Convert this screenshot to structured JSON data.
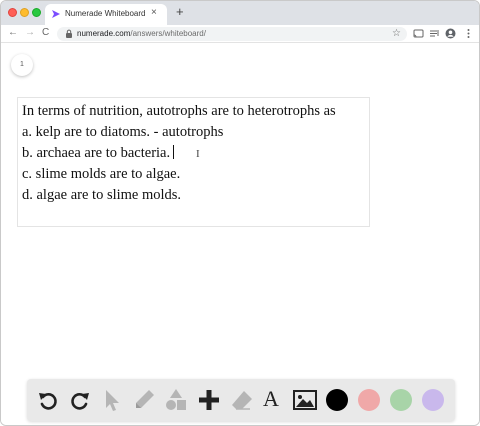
{
  "browser": {
    "tab_title": "Numerade Whiteboard",
    "tab_close": "×",
    "new_tab": "+",
    "nav_back": "←",
    "nav_forward": "→",
    "nav_reload": "C",
    "url_host": "numerade.com",
    "url_path": "/answers/whiteboard/",
    "bookmark": "☆"
  },
  "page": {
    "page_number": "1"
  },
  "question": {
    "lines": [
      "In terms of nutrition, autotrophs are to heterotrophs as",
      "a. kelp are to diatoms. - autotrophs",
      "b. archaea are to bacteria.",
      "c. slime molds are to algae.",
      "d. algae are to slime molds."
    ],
    "cursor_glyph": "I"
  },
  "palette": {
    "text_tool_label": "A",
    "colors": {
      "black": "#000000",
      "red": "#f0a8a8",
      "green": "#a8d4a8",
      "purple": "#c9b8ec"
    }
  },
  "icons": [
    "undo-icon",
    "redo-icon",
    "select-pointer-icon",
    "pen-icon",
    "shapes-icon",
    "plus-icon",
    "eraser-icon",
    "text-icon",
    "image-icon"
  ]
}
